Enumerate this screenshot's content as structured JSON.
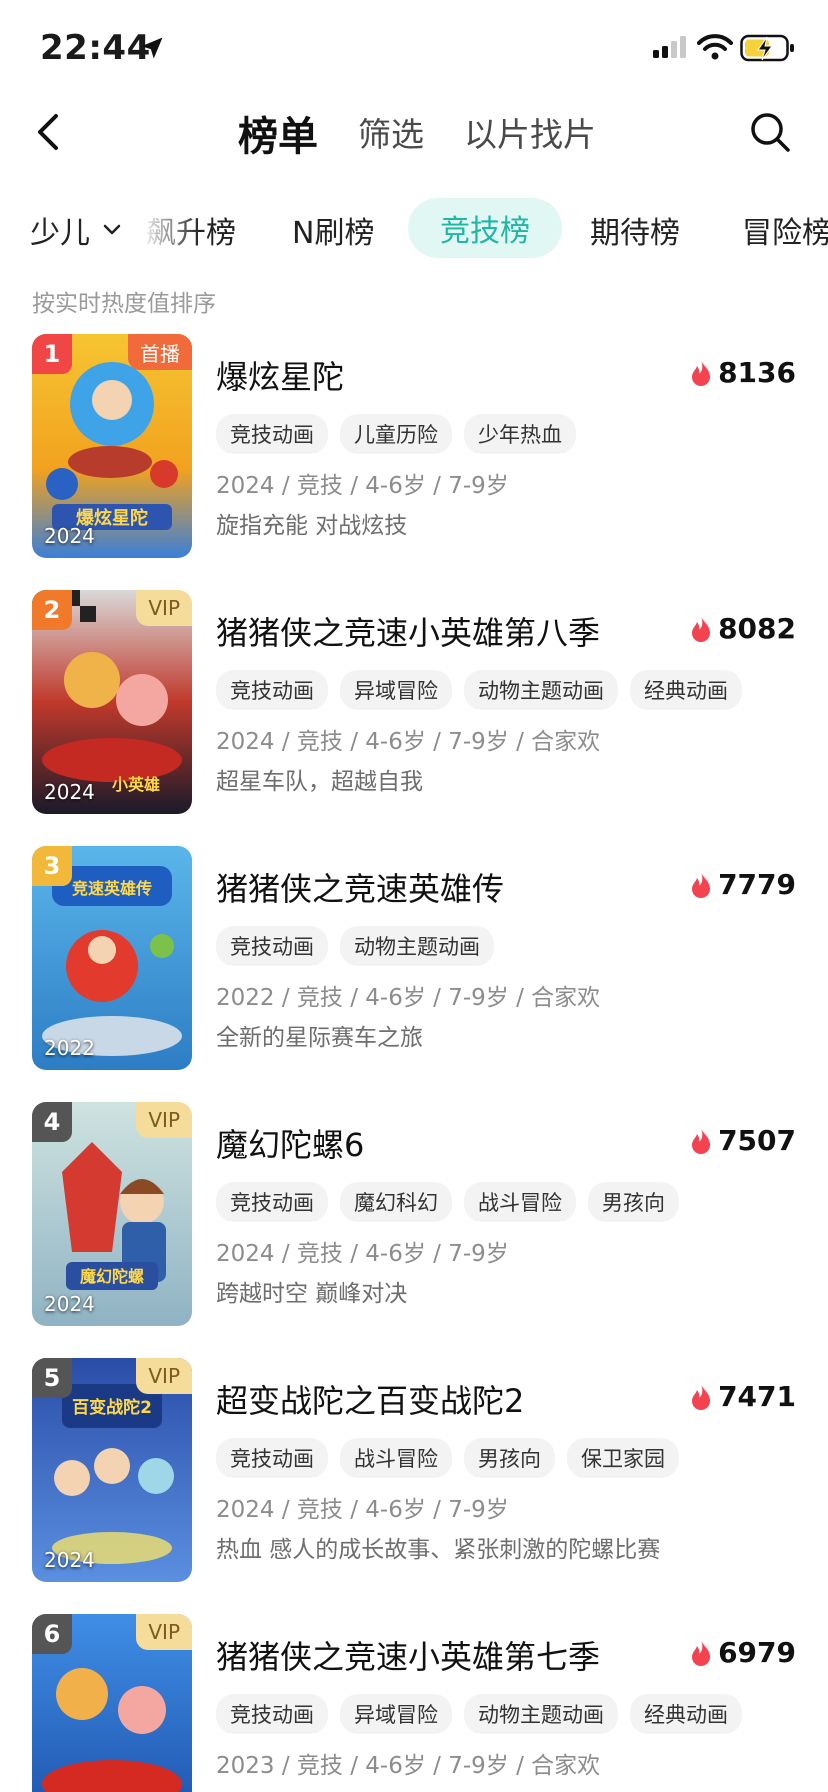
{
  "status": {
    "time": "22:44"
  },
  "nav": {
    "tabs": [
      {
        "label": "榜单",
        "active": true
      },
      {
        "label": "筛选",
        "active": false
      },
      {
        "label": "以片找片",
        "active": false
      }
    ]
  },
  "categories": {
    "dropdown": "少儿",
    "tabs": [
      "飙升榜",
      "N刷榜",
      "竞技榜",
      "期待榜",
      "冒险榜"
    ],
    "active": "竞技榜"
  },
  "sort_note": "按实时热度值排序",
  "colors": {
    "accent": "#1fb7a4",
    "rank1": "#f04646",
    "rank2": "#f07a2a",
    "rank3": "#f2b83a",
    "rank_other": "#555555"
  },
  "items": [
    {
      "rank": "1",
      "badge": "首播",
      "badge_type": "premiere",
      "poster_year": "2024",
      "title": "爆炫星陀",
      "heat": "8136",
      "tags": [
        "竞技动画",
        "儿童历险",
        "少年热血"
      ],
      "meta": "2024 / 竞技 / 4-6岁 / 7-9岁",
      "desc": "旋指充能 对战炫技",
      "poster_logo": "爆炫星陀"
    },
    {
      "rank": "2",
      "badge": "VIP",
      "badge_type": "vip",
      "poster_year": "2024",
      "title": "猪猪侠之竞速小英雄第八季",
      "heat": "8082",
      "tags": [
        "竞技动画",
        "异域冒险",
        "动物主题动画",
        "经典动画"
      ],
      "meta": "2024 / 竞技 / 4-6岁 / 7-9岁 / 合家欢",
      "desc": "超星车队，超越自我",
      "poster_logo": "小英雄"
    },
    {
      "rank": "3",
      "badge": "",
      "badge_type": "",
      "poster_year": "2022",
      "title": "猪猪侠之竞速英雄传",
      "heat": "7779",
      "tags": [
        "竞技动画",
        "动物主题动画"
      ],
      "meta": "2022 / 竞技 / 4-6岁 / 7-9岁 / 合家欢",
      "desc": "全新的星际赛车之旅",
      "poster_logo": "竞速英雄传"
    },
    {
      "rank": "4",
      "badge": "VIP",
      "badge_type": "vip",
      "poster_year": "2024",
      "title": "魔幻陀螺6",
      "heat": "7507",
      "tags": [
        "竞技动画",
        "魔幻科幻",
        "战斗冒险",
        "男孩向"
      ],
      "meta": "2024 / 竞技 / 4-6岁 / 7-9岁",
      "desc": "跨越时空 巅峰对决",
      "poster_logo": "魔幻陀螺"
    },
    {
      "rank": "5",
      "badge": "VIP",
      "badge_type": "vip",
      "poster_year": "2024",
      "title": "超变战陀之百变战陀2",
      "heat": "7471",
      "tags": [
        "竞技动画",
        "战斗冒险",
        "男孩向",
        "保卫家园"
      ],
      "meta": "2024 / 竞技 / 4-6岁 / 7-9岁",
      "desc": "热血 感人的成长故事、紧张刺激的陀螺比赛",
      "poster_logo": "百变战陀2"
    },
    {
      "rank": "6",
      "badge": "VIP",
      "badge_type": "vip",
      "poster_year": "",
      "title": "猪猪侠之竞速小英雄第七季",
      "heat": "6979",
      "tags": [
        "竞技动画",
        "异域冒险",
        "动物主题动画",
        "经典动画"
      ],
      "meta": "2023 / 竞技 / 4-6岁 / 7-9岁 / 合家欢",
      "desc": "",
      "poster_logo": ""
    }
  ]
}
